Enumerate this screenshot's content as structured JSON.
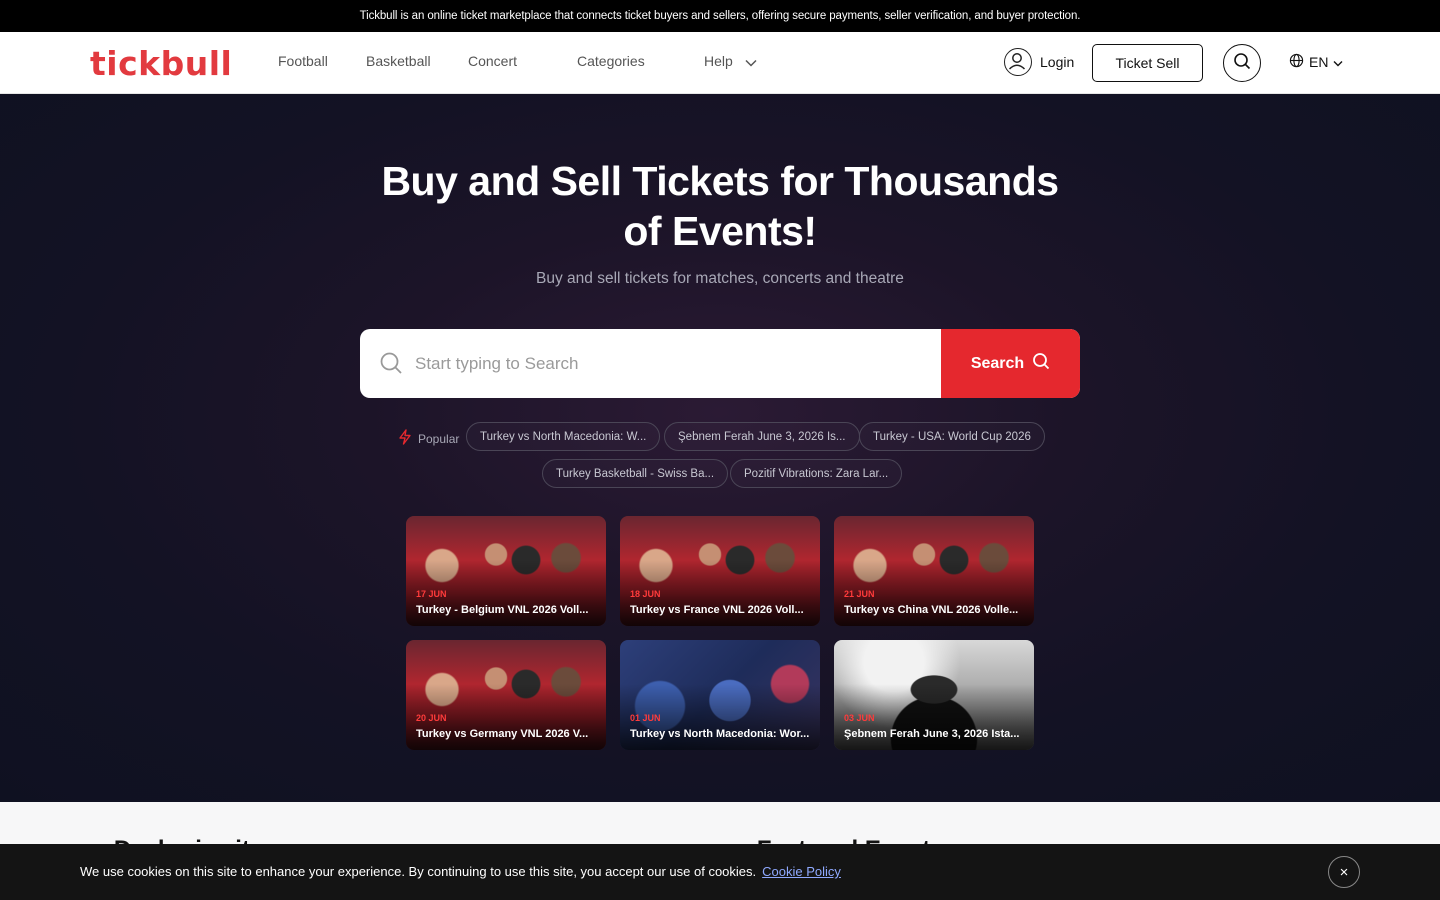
{
  "announcement": "Tickbull is an online ticket marketplace that connects ticket buyers and sellers, offering secure payments, seller verification, and buyer protection.",
  "header": {
    "logo": "tickbull",
    "nav": [
      "Football",
      "Basketball",
      "Concert",
      "Categories",
      "Help"
    ],
    "login": "Login",
    "ticket_sell": "Ticket Sell",
    "language": "EN"
  },
  "hero": {
    "title": "Buy and Sell Tickets for Thousands of Events!",
    "subtitle": "Buy and sell tickets for matches, concerts and theatre",
    "search_placeholder": "Start typing to Search",
    "search_button": "Search",
    "popular_label": "Popular",
    "popular": [
      "Turkey vs North Macedonia: W...",
      "Şebnem Ferah June 3, 2026 Is...",
      "Turkey - USA: World Cup 2026",
      "Turkey Basketball - Swiss Ba...",
      "Pozitif Vibrations: Zara Lar..."
    ]
  },
  "events": [
    {
      "date": "17 JUN",
      "title": "Turkey - Belgium VNL 2026 Voll...",
      "image": "volleyball-team"
    },
    {
      "date": "18 JUN",
      "title": "Turkey vs France VNL 2026 Voll...",
      "image": "volleyball-team"
    },
    {
      "date": "21 JUN",
      "title": "Turkey vs China VNL 2026 Volle...",
      "image": "volleyball-team"
    },
    {
      "date": "20 JUN",
      "title": "Turkey vs Germany VNL 2026 V...",
      "image": "volleyball-team"
    },
    {
      "date": "01 JUN",
      "title": "Turkey vs North Macedonia: Wor...",
      "image": "football-crowd"
    },
    {
      "date": "03 JUN",
      "title": "Şebnem Ferah June 3, 2026 Ista...",
      "image": "concert-singer"
    }
  ],
  "sections": {
    "left_title": "Deal price it",
    "right_title": "Featured Events"
  },
  "cookie": {
    "text": "We use cookies on this site to enhance your experience. By continuing to use this site, you accept our use of cookies.",
    "link": "Cookie Policy",
    "close": "×"
  },
  "colors": {
    "brand": "#e23a3f",
    "search_button": "#e5282e",
    "hero_background": "#131224",
    "date_accent": "#ff3b3b"
  }
}
